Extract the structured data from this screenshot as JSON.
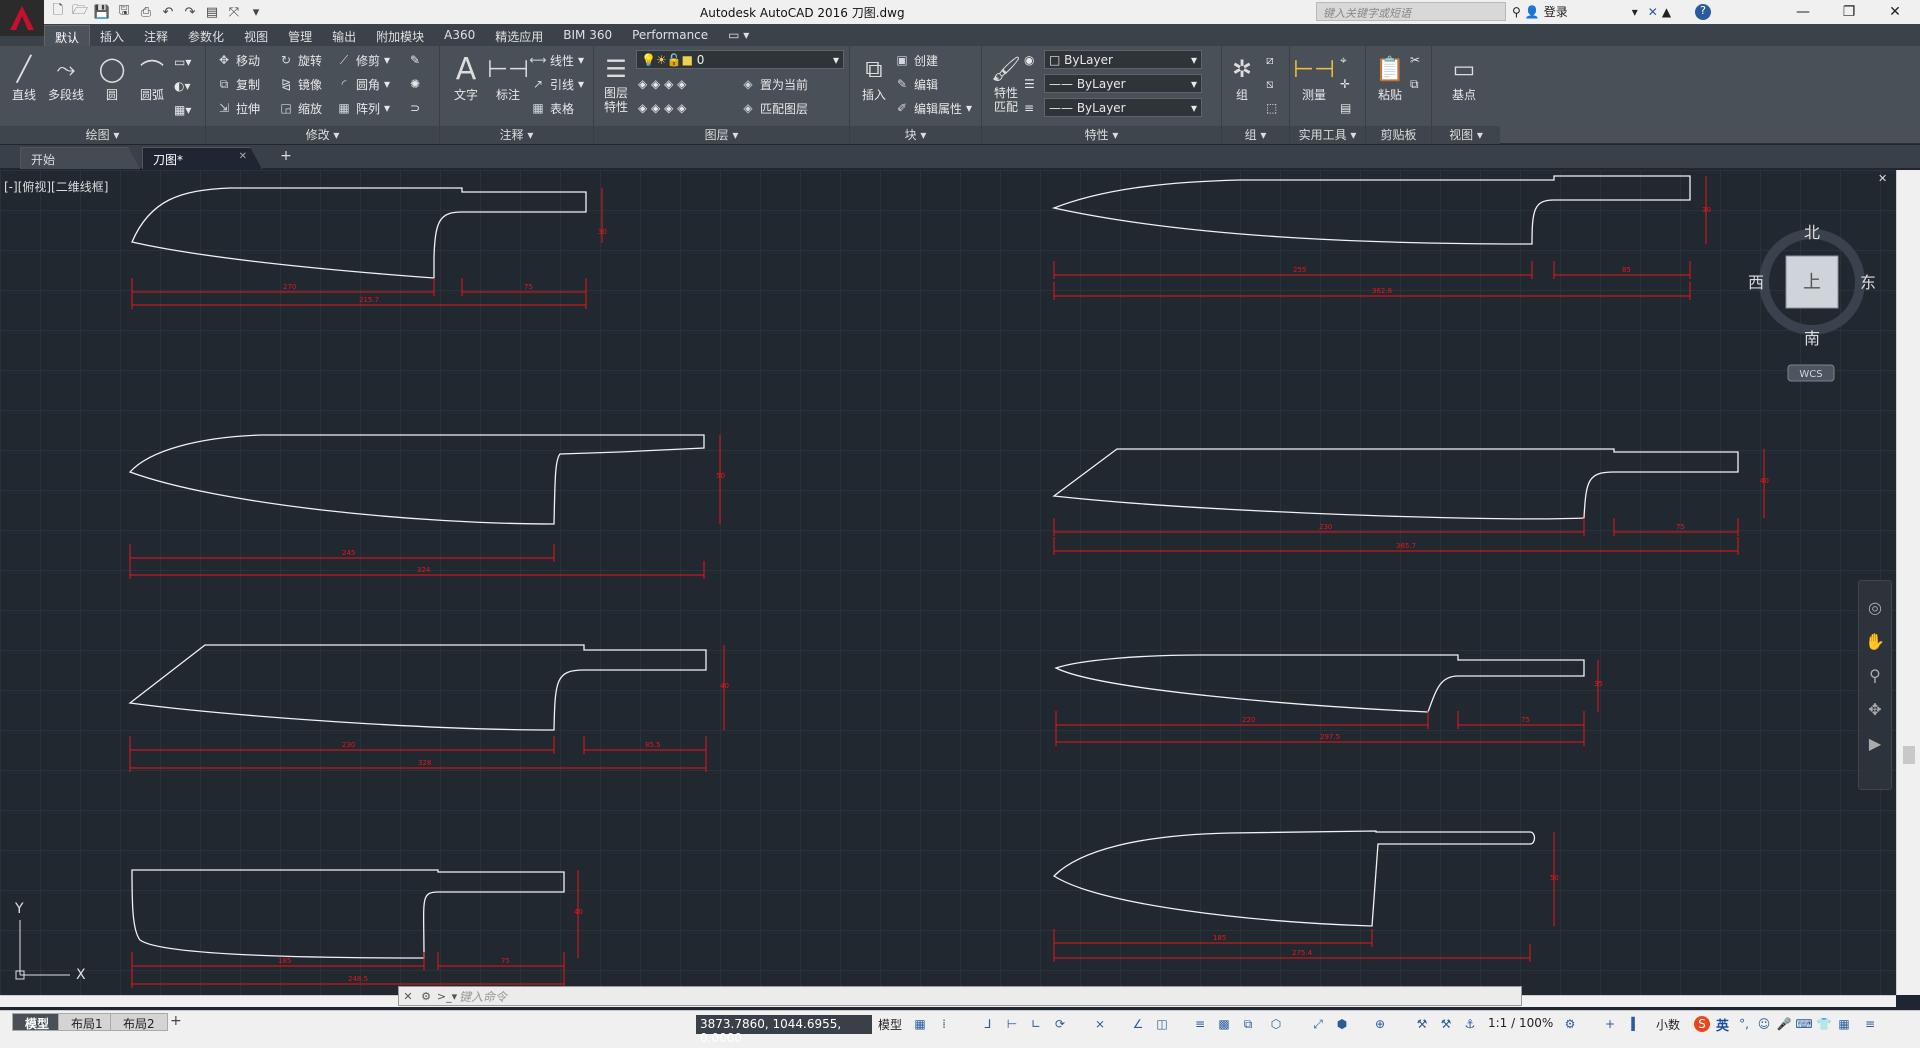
{
  "app": {
    "title": "Autodesk AutoCAD 2016    刀图.dwg",
    "search_placeholder": "键入关键字或短语",
    "login_label": "登录",
    "logo_letter": "A"
  },
  "ribbon_tabs": [
    "默认",
    "插入",
    "注释",
    "参数化",
    "视图",
    "管理",
    "输出",
    "附加模块",
    "A360",
    "精选应用",
    "BIM 360",
    "Performance"
  ],
  "ribbon": {
    "draw": {
      "title": "绘图 ▾",
      "line": "直线",
      "polyline": "多段线",
      "circle": "圆",
      "arc": "圆弧"
    },
    "modify": {
      "title": "修改 ▾",
      "move": "移动",
      "rotate": "旋转",
      "trim": "修剪",
      "copy": "复制",
      "mirror": "镜像",
      "fillet": "圆角",
      "stretch": "拉伸",
      "scale": "缩放",
      "array": "阵列"
    },
    "annotation": {
      "title": "注释 ▾",
      "text": "文字",
      "dimension": "标注",
      "linear": "线性",
      "leader": "引线",
      "table": "表格"
    },
    "layers": {
      "title": "图层 ▾",
      "properties": "图层\n特性",
      "layer_value": "0",
      "set_current": "置为当前",
      "match_layer": "匹配图层"
    },
    "block": {
      "title": "块 ▾",
      "insert": "插入",
      "create": "创建",
      "edit": "编辑",
      "edit_attr": "编辑属性"
    },
    "properties": {
      "title": "特性 ▾",
      "match": "特性\n匹配",
      "color": "ByLayer",
      "linetype": "ByLayer",
      "lineweight": "ByLayer"
    },
    "group": {
      "title": "组 ▾",
      "group": "组"
    },
    "utilities": {
      "title": "实用工具 ▾",
      "measure": "测量"
    },
    "clipboard": {
      "title": "剪贴板",
      "paste": "粘贴"
    },
    "view": {
      "title": "视图 ▾",
      "base": "基点"
    }
  },
  "file_tabs": [
    "开始",
    "刀图*"
  ],
  "viewport_label": "[-][俯视][二维线框]",
  "viewcube": {
    "north": "北",
    "south": "南",
    "east": "东",
    "west": "西",
    "face": "上",
    "wcs": "WCS"
  },
  "ucs": {
    "x": "X",
    "y": "Y"
  },
  "knives": [
    {
      "dims": [
        "270",
        "75",
        "215.7",
        "30"
      ]
    },
    {
      "dims": [
        "255",
        "85",
        "362.8",
        "30"
      ]
    },
    {
      "dims": [
        "245",
        "324",
        "50"
      ]
    },
    {
      "dims": [
        "230",
        "75",
        "365.7",
        "40"
      ]
    },
    {
      "dims": [
        "230",
        "85.5",
        "328",
        "40"
      ]
    },
    {
      "dims": [
        "220",
        "75",
        "297.5",
        "35"
      ]
    },
    {
      "dims": [
        "185",
        "75",
        "248.5",
        "40"
      ]
    },
    {
      "dims": [
        "185",
        "275.4",
        "50"
      ]
    }
  ],
  "command_placeholder": "键入命令",
  "status": {
    "layout_tabs": [
      "模型",
      "布局1",
      "布局2"
    ],
    "coords": "3873.7860, 1044.6955, 0.0000",
    "model": "模型",
    "scale": "1:1 / 100%",
    "units": "小数",
    "ime": "英"
  },
  "colors": {
    "dimension": "#e8161a",
    "outline": "#f2f2f2",
    "accent": "#c8102e"
  }
}
